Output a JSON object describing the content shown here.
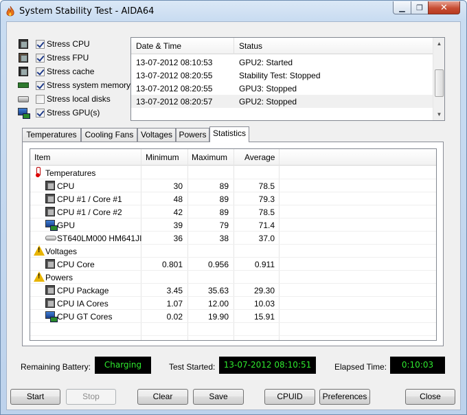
{
  "window": {
    "title": "System Stability Test - AIDA64",
    "controls": {
      "minimize": "▁",
      "maximize": "❐",
      "close": "✕"
    }
  },
  "stress_options": [
    {
      "label": "Stress CPU",
      "checked": true,
      "icon": "cpu-icon"
    },
    {
      "label": "Stress FPU",
      "checked": true,
      "icon": "fpu-icon"
    },
    {
      "label": "Stress cache",
      "checked": true,
      "icon": "cache-icon"
    },
    {
      "label": "Stress system memory",
      "checked": true,
      "icon": "memory-icon"
    },
    {
      "label": "Stress local disks",
      "checked": false,
      "icon": "disk-icon"
    },
    {
      "label": "Stress GPU(s)",
      "checked": true,
      "icon": "gpu-icon"
    }
  ],
  "log": {
    "columns": [
      "Date & Time",
      "Status"
    ],
    "rows": [
      {
        "datetime": "13-07-2012 08:10:53",
        "status": "GPU2: Started"
      },
      {
        "datetime": "13-07-2012 08:20:55",
        "status": "Stability Test: Stopped"
      },
      {
        "datetime": "13-07-2012 08:20:55",
        "status": "GPU3: Stopped"
      },
      {
        "datetime": "13-07-2012 08:20:57",
        "status": "GPU2: Stopped"
      }
    ]
  },
  "tabs": [
    {
      "label": "Temperatures",
      "active": false
    },
    {
      "label": "Cooling Fans",
      "active": false
    },
    {
      "label": "Voltages",
      "active": false
    },
    {
      "label": "Powers",
      "active": false
    },
    {
      "label": "Statistics",
      "active": true
    }
  ],
  "statistics": {
    "columns": [
      "Item",
      "Minimum",
      "Maximum",
      "Average"
    ],
    "groups": [
      {
        "name": "Temperatures",
        "icon": "thermometer-icon",
        "items": [
          {
            "name": "CPU",
            "icon": "cpu-icon",
            "min": "30",
            "max": "89",
            "avg": "78.5"
          },
          {
            "name": "CPU #1 / Core #1",
            "icon": "cpu-icon",
            "min": "48",
            "max": "89",
            "avg": "79.3"
          },
          {
            "name": "CPU #1 / Core #2",
            "icon": "cpu-icon",
            "min": "42",
            "max": "89",
            "avg": "78.5"
          },
          {
            "name": "GPU",
            "icon": "gpu-icon",
            "min": "39",
            "max": "79",
            "avg": "71.4"
          },
          {
            "name": "ST640LM000 HM641JI",
            "icon": "hdd-icon",
            "min": "36",
            "max": "38",
            "avg": "37.0"
          }
        ]
      },
      {
        "name": "Voltages",
        "icon": "warning-icon",
        "items": [
          {
            "name": "CPU Core",
            "icon": "cpu-icon",
            "min": "0.801",
            "max": "0.956",
            "avg": "0.911"
          }
        ]
      },
      {
        "name": "Powers",
        "icon": "warning-icon",
        "items": [
          {
            "name": "CPU Package",
            "icon": "cpu-icon",
            "min": "3.45",
            "max": "35.63",
            "avg": "29.30"
          },
          {
            "name": "CPU IA Cores",
            "icon": "cpu-icon",
            "min": "1.07",
            "max": "12.00",
            "avg": "10.03"
          },
          {
            "name": "CPU GT Cores",
            "icon": "gpu-icon",
            "min": "0.02",
            "max": "19.90",
            "avg": "15.91"
          }
        ]
      }
    ]
  },
  "status": {
    "battery_label": "Remaining Battery:",
    "battery_value": "Charging",
    "started_label": "Test Started:",
    "started_value": "13-07-2012 08:10:51",
    "elapsed_label": "Elapsed Time:",
    "elapsed_value": "0:10:03"
  },
  "buttons": {
    "start": "Start",
    "stop": "Stop",
    "clear": "Clear",
    "save": "Save",
    "cpuid": "CPUID",
    "preferences": "Preferences",
    "close": "Close"
  },
  "colors": {
    "lcd_text": "#2ee82e",
    "lcd_bg": "#000000",
    "title_bar": "#c9dcf1"
  }
}
